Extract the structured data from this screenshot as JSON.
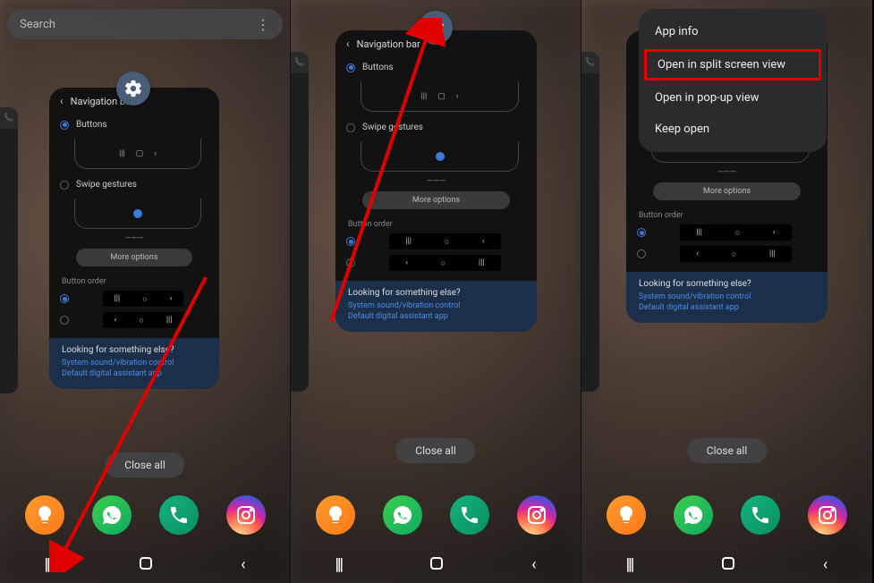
{
  "search_placeholder": "Search",
  "card": {
    "title": "Navigation bar",
    "opt_buttons": "Buttons",
    "opt_swipe": "Swipe gestures",
    "more_options": "More options",
    "button_order": "Button order",
    "looking_q": "Looking for something else?",
    "link1": "System sound/vibration control",
    "link2": "Default digital assistant app"
  },
  "close_all": "Close all",
  "ctx": {
    "app_info": "App info",
    "split": "Open in split screen view",
    "popup": "Open in pop-up view",
    "keep": "Keep open"
  },
  "nav_symbols": {
    "recents": "|||",
    "back": "‹"
  },
  "dock_icons": [
    "tips",
    "whatsapp",
    "phone",
    "instagram"
  ]
}
